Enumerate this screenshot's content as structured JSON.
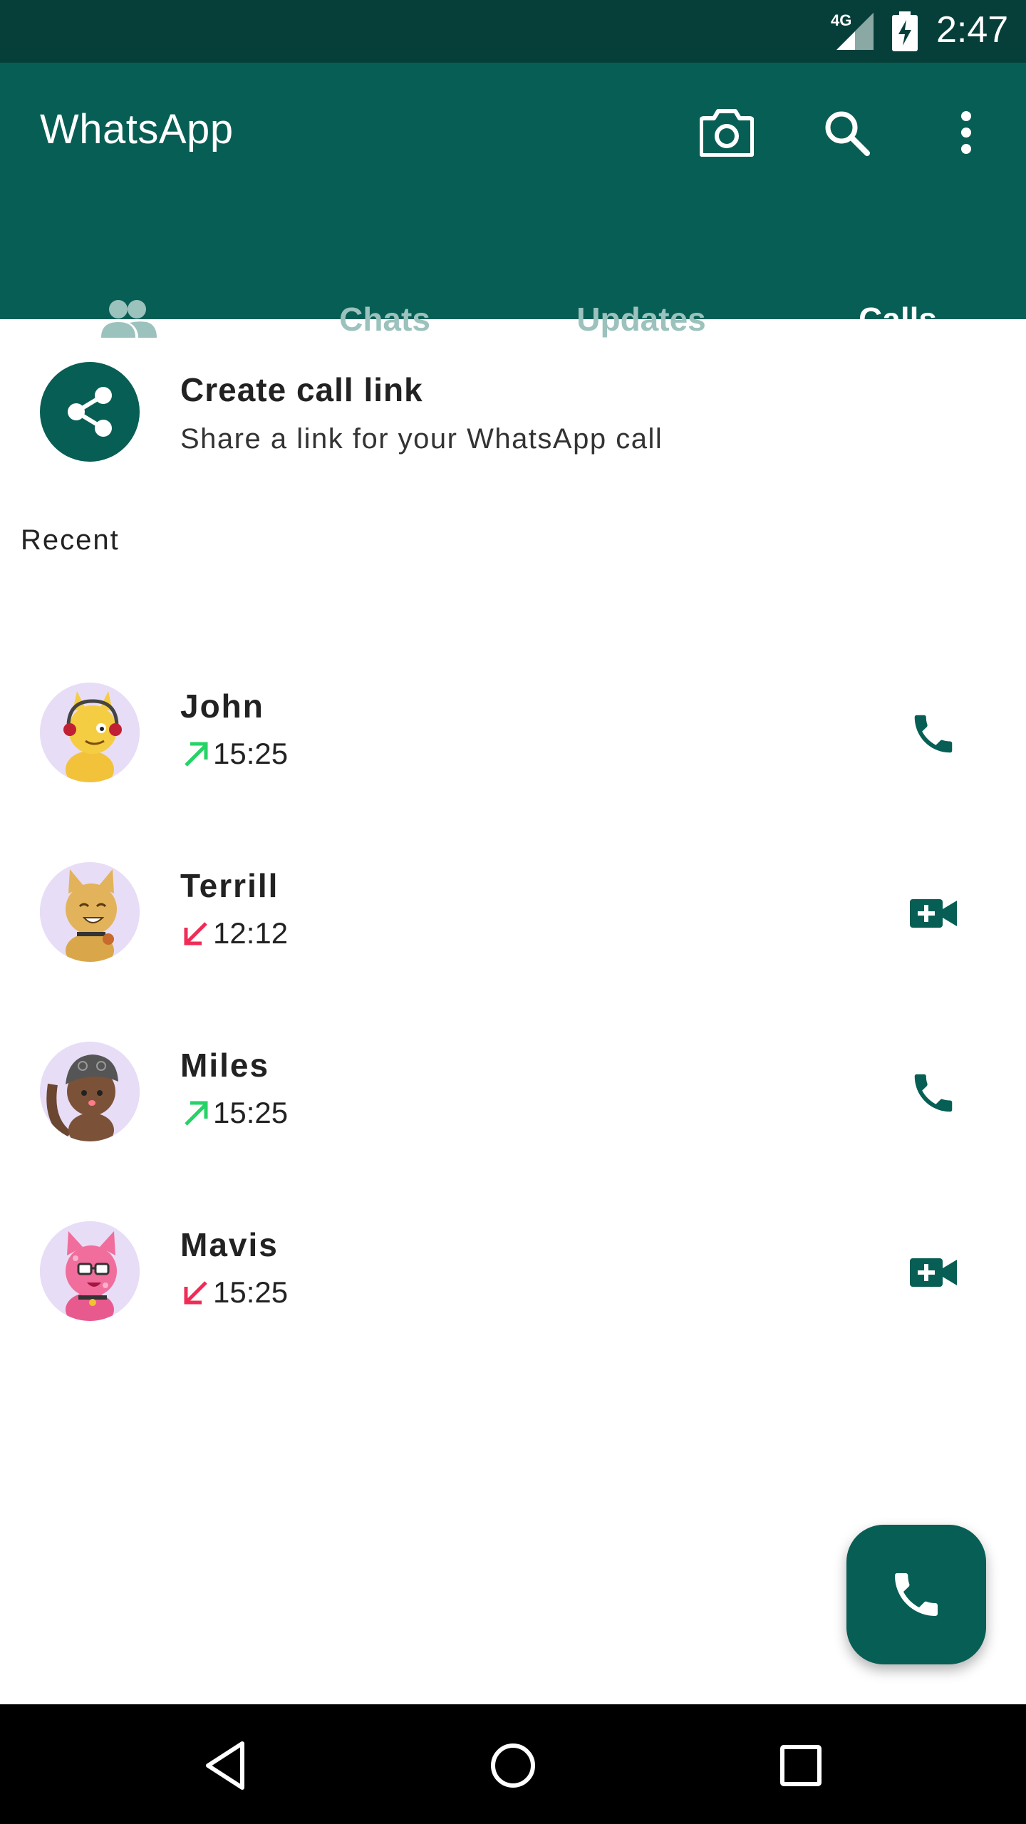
{
  "status_bar": {
    "network": "4G",
    "time": "2:47"
  },
  "app_bar": {
    "title": "WhatsApp",
    "icons": [
      "camera-icon",
      "search-icon",
      "more-vert-icon"
    ]
  },
  "tabs": [
    {
      "label": "",
      "icon": "community-icon"
    },
    {
      "label": "Chats"
    },
    {
      "label": "Updates"
    },
    {
      "label": "Calls",
      "selected": true
    }
  ],
  "create_link": {
    "title": "Create call link",
    "subtitle": "Share a link for your WhatsApp call"
  },
  "recent_label": "Recent",
  "calls": [
    {
      "name": "John",
      "time": "15:25",
      "direction": "outgoing",
      "type": "voice"
    },
    {
      "name": "Terrill",
      "time": "12:12",
      "direction": "incoming-missed",
      "type": "video"
    },
    {
      "name": "Miles",
      "time": "15:25",
      "direction": "outgoing",
      "type": "voice"
    },
    {
      "name": "Mavis",
      "time": "15:25",
      "direction": "incoming-missed",
      "type": "video"
    }
  ],
  "colors": {
    "primary": "#075e54",
    "status_bar": "#063f3a",
    "outgoing_arrow": "#25d366",
    "missed_arrow": "#f02c56",
    "inactive_tab": "#9cc2bd"
  }
}
